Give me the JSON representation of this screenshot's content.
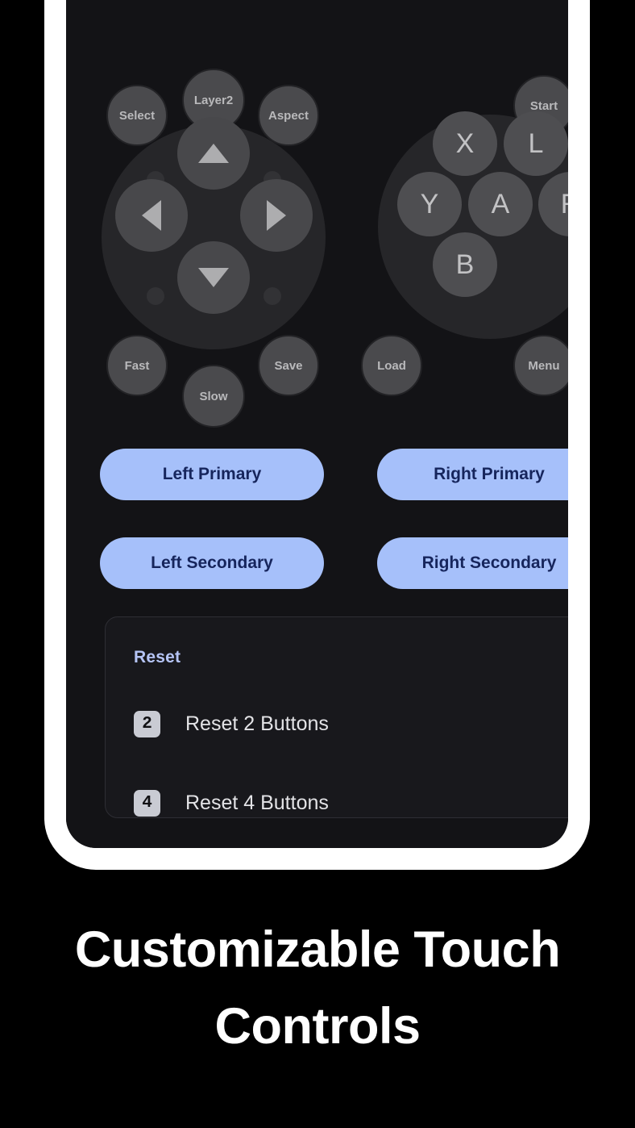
{
  "caption": {
    "line1": "Customizable Touch",
    "line2": "Controls"
  },
  "colors": {
    "accent_blue": "#a6c0fa",
    "accent_blue_text": "#16255c",
    "card_title_blue": "#b5c4f5",
    "screen_background": "#131316",
    "card_background": "#18181c",
    "frame_white": "#ffffff",
    "page_background": "#000000",
    "button_face": "#4b4b4e",
    "pad_base": "#262629"
  },
  "controller": {
    "aux_buttons_top": [
      {
        "label": "Select"
      },
      {
        "label": "Layer2"
      },
      {
        "label": "Aspect"
      },
      {
        "label": "Start"
      }
    ],
    "dpad": {
      "directions": [
        {
          "label": "up-arrow"
        },
        {
          "label": "left-arrow"
        },
        {
          "label": "right-arrow"
        },
        {
          "label": "down-arrow"
        }
      ]
    },
    "face_buttons": [
      {
        "label": "X"
      },
      {
        "label": "L"
      },
      {
        "label": "Y"
      },
      {
        "label": "A"
      },
      {
        "label": "R"
      },
      {
        "label": "B"
      }
    ],
    "aux_buttons_bottom": [
      {
        "label": "Fast"
      },
      {
        "label": "Slow"
      },
      {
        "label": "Save"
      },
      {
        "label": "Load"
      },
      {
        "label": "Menu"
      }
    ]
  },
  "assign": {
    "rows": [
      {
        "left": "Left Primary",
        "right": "Right Primary"
      },
      {
        "left": "Left Secondary",
        "right": "Right Secondary"
      }
    ]
  },
  "reset": {
    "title": "Reset",
    "items": [
      {
        "badge": "2",
        "label": "Reset 2 Buttons"
      },
      {
        "badge": "4",
        "label": "Reset 4 Buttons"
      }
    ]
  }
}
